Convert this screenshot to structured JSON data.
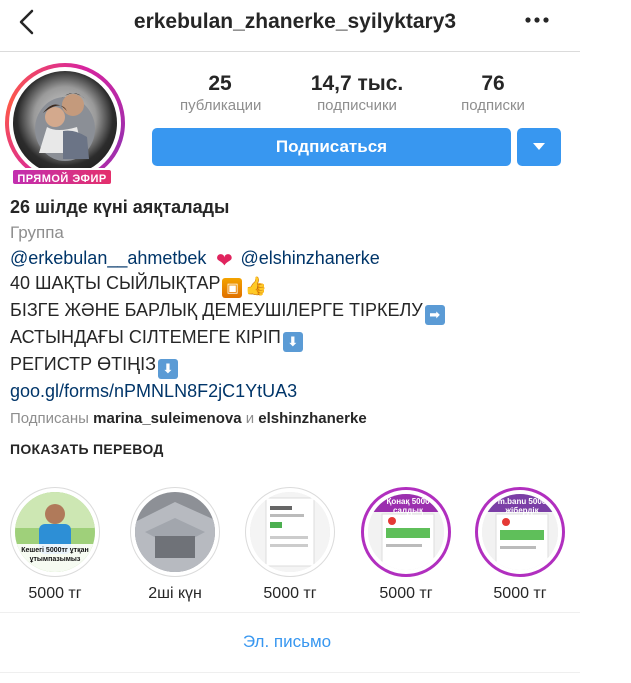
{
  "header": {
    "username": "erkebulan_zhanerke_syilyktary3"
  },
  "profile": {
    "live_badge": "ПРЯМОЙ ЭФИР",
    "stats": [
      {
        "value": "25",
        "label": "публикации"
      },
      {
        "value": "14,7 тыс.",
        "label": "подписчики"
      },
      {
        "value": "76",
        "label": "подписки"
      }
    ],
    "follow_label": "Подписаться",
    "accent_color": "#3897f0"
  },
  "bio": {
    "name": "26 шілде күні аяқталады",
    "category": "Группа",
    "mention1": "@erkebulan__ahmetbek",
    "mention2": "@elshinzhanerke",
    "line1": "40 ШАҚТЫ СЫЙЛЫҚТАР",
    "line2": "БІЗГЕ ЖӘНЕ БАРЛЫҚ ДЕМЕУШІЛЕРГЕ ТІРКЕЛУ",
    "line3": "АСТЫНДАҒЫ СІЛТЕМЕГЕ КІРІП",
    "line4": "РЕГИСТР ӨТІҢІЗ",
    "link": "goo.gl/forms/nPMNLN8F2jC1YtUA3",
    "followed_prefix": "Подписаны",
    "followed_user1": "marina_suleimenova",
    "followed_and": "и",
    "followed_user2": "elshinzhanerke",
    "emoji": {
      "heart": "heart-emoji",
      "gift": "gift-emoji",
      "thumb": "thumbs-up-emoji",
      "arrow_right": "right-arrow-emoji",
      "arrow_down": "down-arrow-emoji"
    }
  },
  "translate_label": "ПОКАЗАТЬ ПЕРЕВОД",
  "highlights": [
    {
      "label": "5000 тг",
      "overlay": "Кешегі 5000тг ұтқан ұтымпазымыз"
    },
    {
      "label": "2ші күн"
    },
    {
      "label": "5000 тг"
    },
    {
      "label": "5000 тг",
      "overlay": "Қонақ 5000 салдық"
    },
    {
      "label": "5000 тг",
      "overlay": "m.banu 5000 жібердік"
    }
  ],
  "email_label": "Эл. письмо"
}
